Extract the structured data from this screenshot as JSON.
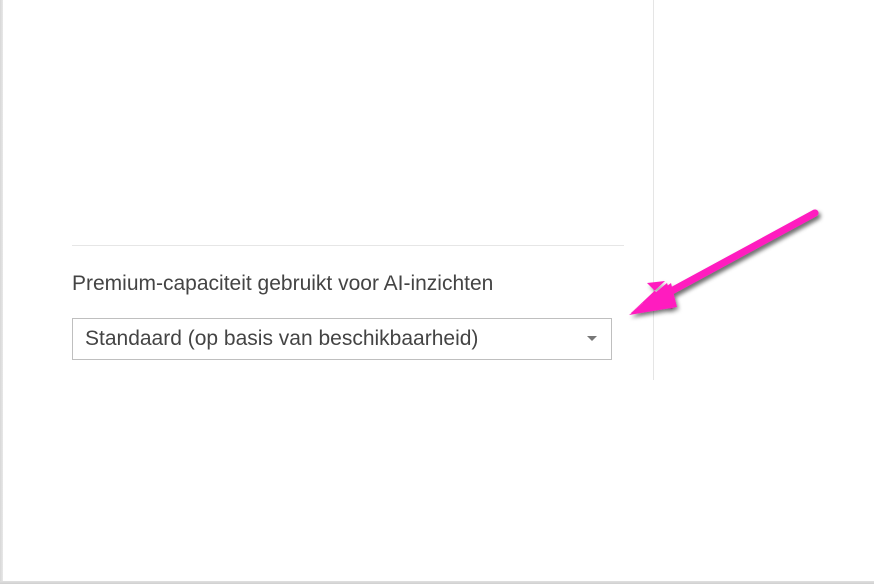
{
  "section": {
    "label": "Premium-capaciteit gebruikt voor AI-inzichten",
    "dropdown": {
      "selected": "Standaard (op basis van beschikbaarheid)"
    }
  },
  "annotation": {
    "color": "#ff1fbf"
  }
}
